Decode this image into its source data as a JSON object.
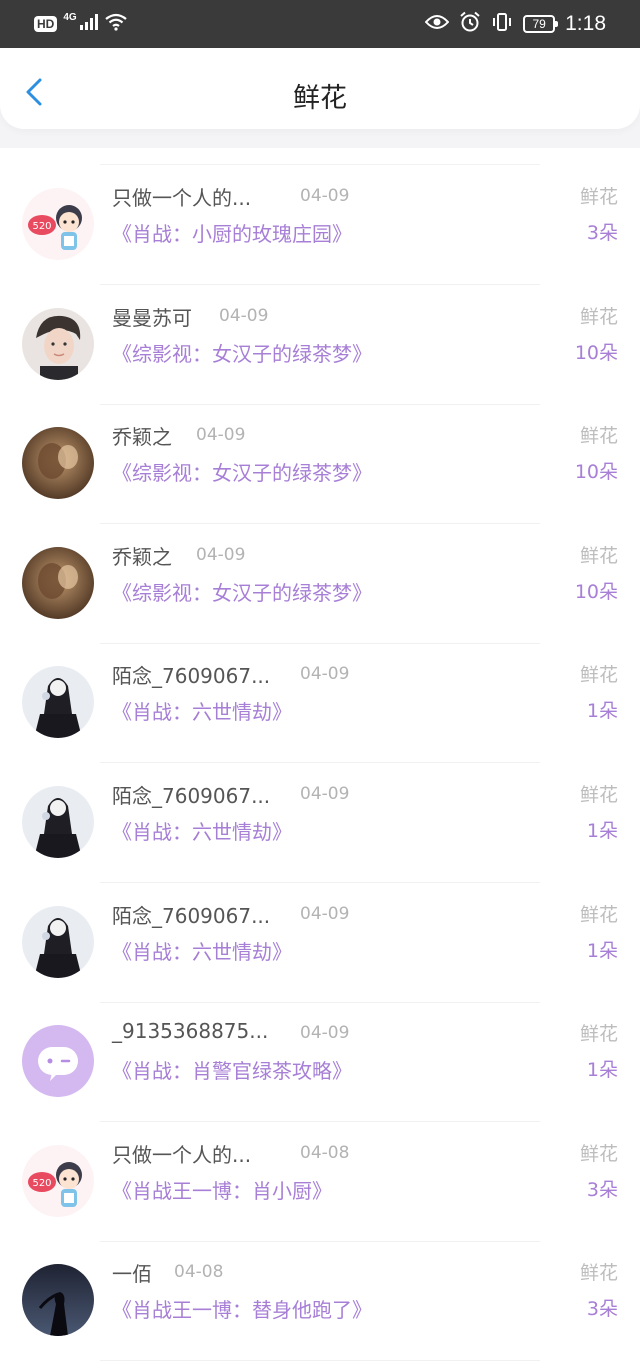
{
  "status_bar": {
    "hd": "HD",
    "network": "4G",
    "battery": "79",
    "time": "1:18"
  },
  "header": {
    "title": "鲜花",
    "back_icon": "chevron-left-icon"
  },
  "colors": {
    "accent": "#a77fd6",
    "back_arrow": "#2d8fe0",
    "status_bar_bg": "#3a3a3a"
  },
  "items": [
    {
      "user": "只做一个人的...",
      "date": "04-09",
      "book": "《肖战：小厨的玫瑰庄园》",
      "gift": "鲜花",
      "count": "3朵",
      "avatar": "cartoon-520"
    },
    {
      "user": "曼曼苏可",
      "date": "04-09",
      "book": "《综影视：女汉子的绿茶梦》",
      "gift": "鲜花",
      "count": "10朵",
      "avatar": "portrait"
    },
    {
      "user": "乔颖之",
      "date": "04-09",
      "book": "《综影视：女汉子的绿茶梦》",
      "gift": "鲜花",
      "count": "10朵",
      "avatar": "sepia"
    },
    {
      "user": "乔颖之",
      "date": "04-09",
      "book": "《综影视：女汉子的绿茶梦》",
      "gift": "鲜花",
      "count": "10朵",
      "avatar": "sepia"
    },
    {
      "user": "陌念_7609067...",
      "date": "04-09",
      "book": "《肖战：六世情劫》",
      "gift": "鲜花",
      "count": "1朵",
      "avatar": "dark-figure"
    },
    {
      "user": "陌念_7609067...",
      "date": "04-09",
      "book": "《肖战：六世情劫》",
      "gift": "鲜花",
      "count": "1朵",
      "avatar": "dark-figure"
    },
    {
      "user": "陌念_7609067...",
      "date": "04-09",
      "book": "《肖战：六世情劫》",
      "gift": "鲜花",
      "count": "1朵",
      "avatar": "dark-figure"
    },
    {
      "user": "_9135368875...",
      "date": "04-09",
      "book": "《肖战：肖警官绿茶攻略》",
      "gift": "鲜花",
      "count": "1朵",
      "avatar": "default-wink"
    },
    {
      "user": "只做一个人的...",
      "date": "04-08",
      "book": "《肖战王一博：肖小厨》",
      "gift": "鲜花",
      "count": "3朵",
      "avatar": "cartoon-520"
    },
    {
      "user": "一佰",
      "date": "04-08",
      "book": "《肖战王一博：替身他跑了》",
      "gift": "鲜花",
      "count": "3朵",
      "avatar": "night-silhouette"
    }
  ]
}
